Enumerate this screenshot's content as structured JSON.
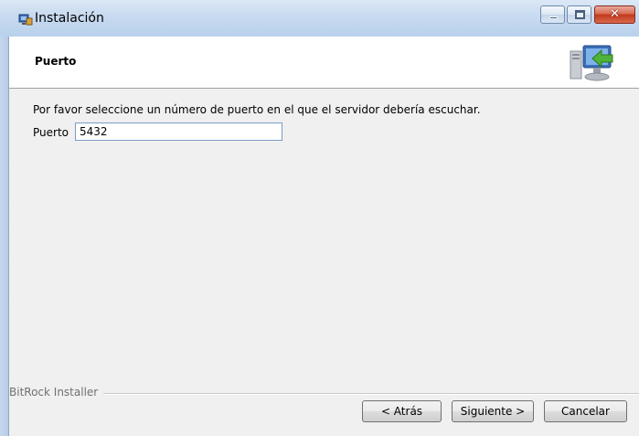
{
  "window": {
    "title": "Instalación",
    "close_glyph": "✕"
  },
  "header": {
    "title": "Puerto",
    "icon": "computer-network-icon"
  },
  "main": {
    "prompt": "Por favor seleccione un número de puerto en el que el servidor debería escuchar.",
    "port_label": "Puerto",
    "port_value": "5432"
  },
  "footer": {
    "brand": "BitRock Installer",
    "back_label": "< Atrás",
    "next_label": "Siguiente >",
    "cancel_label": "Cancelar"
  },
  "colors": {
    "titlebar": "#c7daf0",
    "close_button": "#c2381d",
    "body_background": "#f0f0f0",
    "header_background": "#ffffff"
  }
}
